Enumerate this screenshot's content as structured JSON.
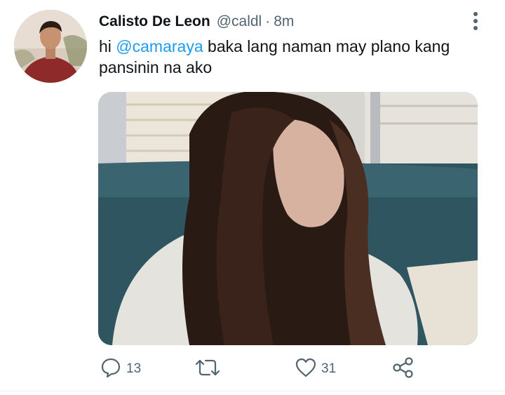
{
  "tweet": {
    "author_name": "Calisto De Leon",
    "handle": "@caldl",
    "separator": "·",
    "time": "8m",
    "text_prefix": "hi ",
    "mention": "@camaraya",
    "text_rest": " baka lang naman may plano kang pansinin na ako"
  },
  "actions": {
    "reply_count": "13",
    "like_count": "31"
  },
  "icons": {
    "more": "more-vertical-icon",
    "reply": "reply-icon",
    "retweet": "retweet-icon",
    "like": "heart-icon",
    "share": "share-icon"
  },
  "colors": {
    "mention": "#1d9bf0",
    "secondary_text": "#536471",
    "primary_text": "#0f1419"
  }
}
